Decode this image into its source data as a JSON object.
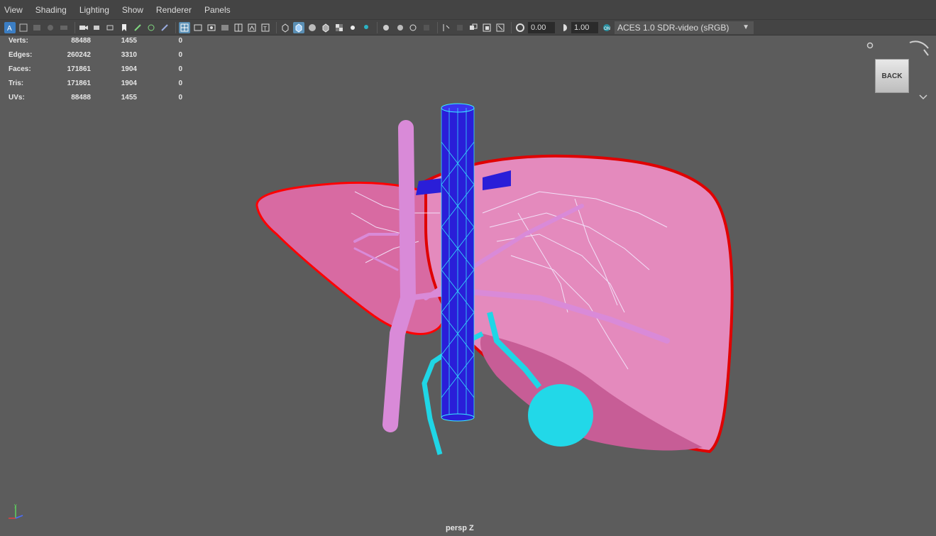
{
  "menu": [
    "View",
    "Shading",
    "Lighting",
    "Show",
    "Renderer",
    "Panels"
  ],
  "toolbar": {
    "exposure_value": "0.00",
    "gamma_value": "1.00",
    "color_space": "ACES 1.0 SDR-video (sRGB)"
  },
  "hud": {
    "rows": [
      {
        "label": "Verts:",
        "v1": "88488",
        "v2": "1455",
        "v3": "0"
      },
      {
        "label": "Edges:",
        "v1": "260242",
        "v2": "3310",
        "v3": "0"
      },
      {
        "label": "Faces:",
        "v1": "171861",
        "v2": "1904",
        "v3": "0"
      },
      {
        "label": "Tris:",
        "v1": "171861",
        "v2": "1904",
        "v3": "0"
      },
      {
        "label": "UVs:",
        "v1": "88488",
        "v2": "1455",
        "v3": "0"
      }
    ]
  },
  "viewcube": {
    "face_label": "BACK"
  },
  "camera_label": "persp Z",
  "axis": {
    "y": "y",
    "x": "x",
    "z": "z"
  },
  "colors": {
    "viewport_bg": "#5c5c5c",
    "liver": "#e07bb0",
    "vena_cava": "#2a1ed8",
    "portal_vein": "#d98ad8",
    "gallbladder": "#1fd6e6",
    "outline": "#ff0000"
  }
}
